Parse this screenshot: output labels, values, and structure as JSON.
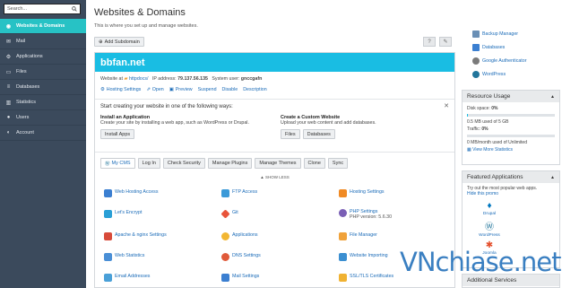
{
  "sidebar": {
    "search_placeholder": "Search...",
    "items": [
      {
        "label": "Websites & Domains",
        "icon": "globe-icon",
        "active": true
      },
      {
        "label": "Mail",
        "icon": "mail-icon"
      },
      {
        "label": "Applications",
        "icon": "apps-icon"
      },
      {
        "label": "Files",
        "icon": "folder-icon"
      },
      {
        "label": "Databases",
        "icon": "database-icon"
      },
      {
        "label": "Statistics",
        "icon": "chart-icon"
      },
      {
        "label": "Users",
        "icon": "user-icon"
      },
      {
        "label": "Account",
        "icon": "account-icon"
      }
    ]
  },
  "main": {
    "title": "Websites & Domains",
    "subtitle": "This is where you set up and manage websites.",
    "add_subdomain": "Add Subdomain",
    "domain": {
      "name": "bbfan.net",
      "website_at": "Website at",
      "httpdocs": "httpdocs/",
      "ip_label": "IP address:",
      "ip": "79.137.56.135",
      "user_label": "System user:",
      "user": "gnccgafn",
      "actions": [
        "Hosting Settings",
        "Open",
        "Preview",
        "Suspend",
        "Disable",
        "Description"
      ]
    },
    "start": {
      "title": "Start creating your website in one of the following ways:",
      "install_title": "Install an Application",
      "install_text": "Create your site by installing a web app, such as WordPress or Drupal.",
      "install_btn": "Install Apps",
      "create_title": "Create a Custom Website",
      "create_text": "Upload your web content and add databases.",
      "files_btn": "Files",
      "databases_btn": "Databases"
    },
    "tabs": [
      "My CMS",
      "Log In",
      "Check Security",
      "Manage Plugins",
      "Manage Themes",
      "Clone",
      "Sync"
    ],
    "show_less": "▲ SHOW LESS",
    "tools": [
      {
        "label": "Web Hosting Access",
        "color": "#3b7fd1"
      },
      {
        "label": "FTP Access",
        "color": "#3b9ad8"
      },
      {
        "label": "Hosting Settings",
        "color": "#f08a24"
      },
      {
        "label": "Let's Encrypt",
        "color": "#2a9fd6"
      },
      {
        "label": "Git",
        "color": "#e8543a"
      },
      {
        "label": "PHP Settings",
        "sub": "PHP version: 5.6.30",
        "color": "#7a5fb5"
      },
      {
        "label": "Apache & nginx Settings",
        "color": "#d84b3a"
      },
      {
        "label": "Applications",
        "color": "#f2b632"
      },
      {
        "label": "File Manager",
        "color": "#f0a23a"
      },
      {
        "label": "Web Statistics",
        "color": "#4a8fd6"
      },
      {
        "label": "DNS Settings",
        "color": "#e05a3a"
      },
      {
        "label": "Website Importing",
        "color": "#3b8fd1"
      },
      {
        "label": "Email Addresses",
        "color": "#4aa0d8"
      },
      {
        "label": "Mail Settings",
        "color": "#3b7fd1"
      },
      {
        "label": "SSL/TLS Certificates",
        "color": "#f0b232"
      }
    ]
  },
  "right": {
    "links": [
      {
        "label": "Backup Manager",
        "color": "#6a8fb5"
      },
      {
        "label": "Databases",
        "color": "#3b7fd1"
      },
      {
        "label": "Google Authenticator",
        "color": "#7a7a7a"
      },
      {
        "label": "WordPress",
        "color": "#21759b"
      }
    ],
    "resource": {
      "title": "Resource Usage",
      "disk_label": "Disk space:",
      "disk_pct": "0%",
      "disk_fill": 0.01,
      "disk_text": "0.5 MB used of 5 GB",
      "traffic_label": "Traffic:",
      "traffic_pct": "0%",
      "traffic_fill": 0.0,
      "traffic_text": "0 MB/month used of Unlimited",
      "more_stats": "View More Statistics"
    },
    "featured": {
      "title": "Featured Applications",
      "intro": "Try out the most popular web apps.",
      "hide": "Hide this promo",
      "apps": [
        "Drupal",
        "WordPress",
        "Joomla"
      ]
    },
    "additional": "Additional Services"
  },
  "watermark": "VNchiase.net"
}
